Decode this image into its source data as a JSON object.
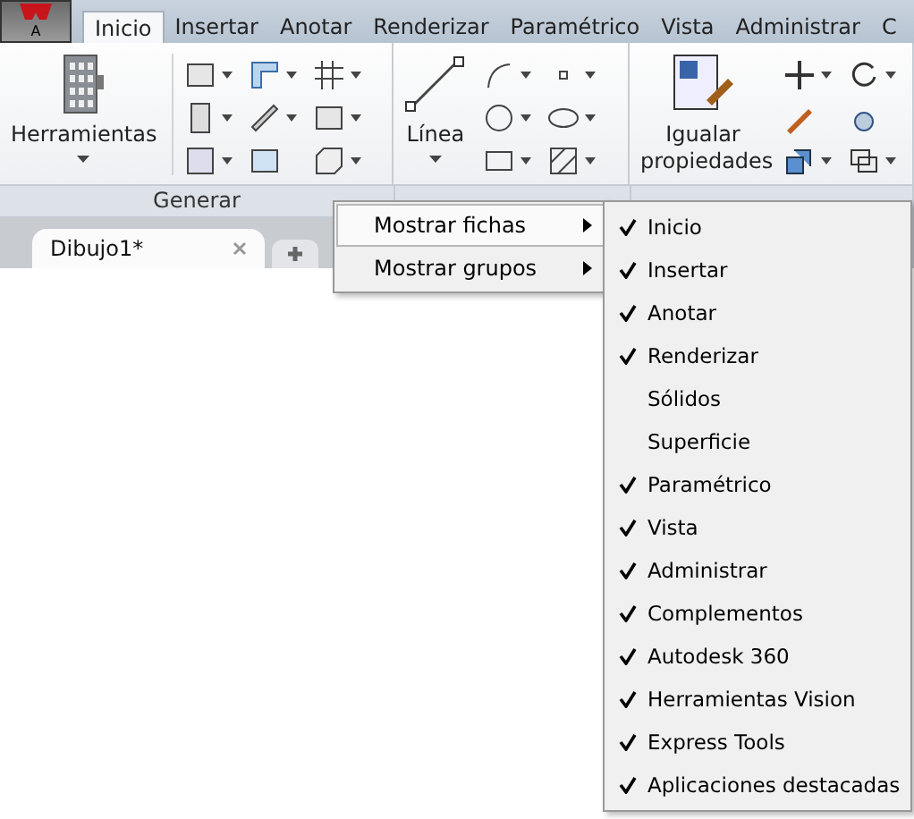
{
  "app_button": {
    "label": "A"
  },
  "tabs": [
    {
      "label": "Inicio",
      "selected": true
    },
    {
      "label": "Insertar",
      "selected": false
    },
    {
      "label": "Anotar",
      "selected": false
    },
    {
      "label": "Renderizar",
      "selected": false
    },
    {
      "label": "Paramétrico",
      "selected": false
    },
    {
      "label": "Vista",
      "selected": false
    },
    {
      "label": "Administrar",
      "selected": false
    },
    {
      "label": "C",
      "selected": false
    }
  ],
  "big_tools": [
    {
      "label": "Herramientas"
    },
    {
      "label": "Línea"
    },
    {
      "label": "Igualar propiedades"
    }
  ],
  "panel_label": "Generar",
  "document_tabs": [
    {
      "label": "Dibujo1*",
      "selected": true
    }
  ],
  "context_menu": {
    "items": [
      {
        "label": "Mostrar fichas",
        "selected": true
      },
      {
        "label": "Mostrar grupos",
        "selected": false
      }
    ]
  },
  "submenu": {
    "items": [
      {
        "label": "Inicio",
        "checked": true
      },
      {
        "label": "Insertar",
        "checked": true
      },
      {
        "label": "Anotar",
        "checked": true
      },
      {
        "label": "Renderizar",
        "checked": true
      },
      {
        "label": "Sólidos",
        "checked": false
      },
      {
        "label": "Superficie",
        "checked": false
      },
      {
        "label": "Paramétrico",
        "checked": true
      },
      {
        "label": "Vista",
        "checked": true
      },
      {
        "label": "Administrar",
        "checked": true
      },
      {
        "label": "Complementos",
        "checked": true
      },
      {
        "label": "Autodesk 360",
        "checked": true
      },
      {
        "label": "Herramientas Vision",
        "checked": true
      },
      {
        "label": "Express Tools",
        "checked": true
      },
      {
        "label": "Aplicaciones destacadas",
        "checked": true
      }
    ]
  }
}
